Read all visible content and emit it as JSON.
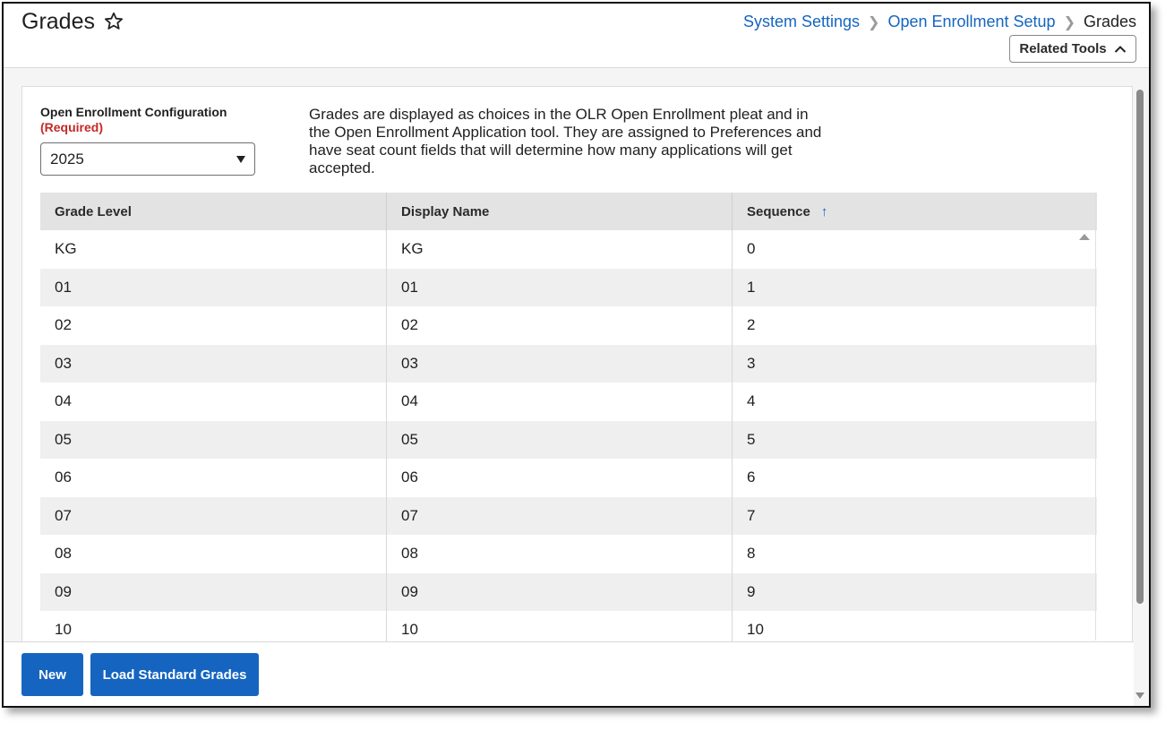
{
  "header": {
    "title": "Grades",
    "breadcrumb": [
      {
        "label": "System Settings"
      },
      {
        "label": "Open Enrollment Setup"
      },
      {
        "label": "Grades"
      }
    ],
    "related_tools_label": "Related Tools"
  },
  "config": {
    "label": "Open Enrollment Configuration",
    "required": "(Required)",
    "selected_value": "2025"
  },
  "description": "Grades are displayed as choices in the OLR Open Enrollment pleat and in the Open Enrollment Application tool. They are assigned to Preferences and have seat count fields that will determine how many applications will get accepted.",
  "grid": {
    "columns": [
      "Grade Level",
      "Display Name",
      "Sequence"
    ],
    "sort_column": "Sequence",
    "sort_direction": "ascending",
    "rows": [
      [
        "KG",
        "KG",
        "0"
      ],
      [
        "01",
        "01",
        "1"
      ],
      [
        "02",
        "02",
        "2"
      ],
      [
        "03",
        "03",
        "3"
      ],
      [
        "04",
        "04",
        "4"
      ],
      [
        "05",
        "05",
        "5"
      ],
      [
        "06",
        "06",
        "6"
      ],
      [
        "07",
        "07",
        "7"
      ],
      [
        "08",
        "08",
        "8"
      ],
      [
        "09",
        "09",
        "9"
      ],
      [
        "10",
        "10",
        "10"
      ]
    ]
  },
  "footer": {
    "new_label": "New",
    "load_label": "Load Standard Grades"
  },
  "colors": {
    "accent": "#1565c0",
    "required": "#c62828"
  }
}
